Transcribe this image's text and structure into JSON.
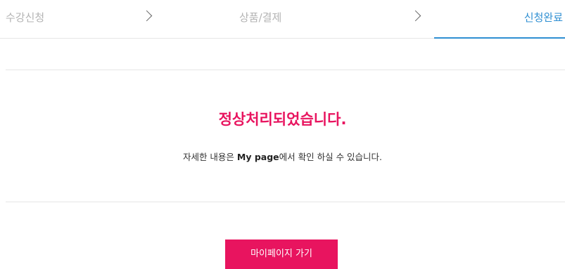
{
  "steps": {
    "items": [
      {
        "label": "수강신청",
        "state": "inactive"
      },
      {
        "label": "상품/결제",
        "state": "inactive"
      },
      {
        "label": "신청완료",
        "state": "active"
      }
    ],
    "separator_icon": "chevron-right-icon"
  },
  "result": {
    "title": "정상처리되었습니다.",
    "desc_prefix": "자세한 내용은 ",
    "desc_link": "My page",
    "desc_suffix": "에서 확인 하실 수 있습니다."
  },
  "actions": {
    "mypage_button_label": "마이페이지 가기"
  },
  "colors": {
    "accent": "#e8145f",
    "active_step": "#2f8fd2",
    "inactive_step": "#b3b3b3"
  }
}
